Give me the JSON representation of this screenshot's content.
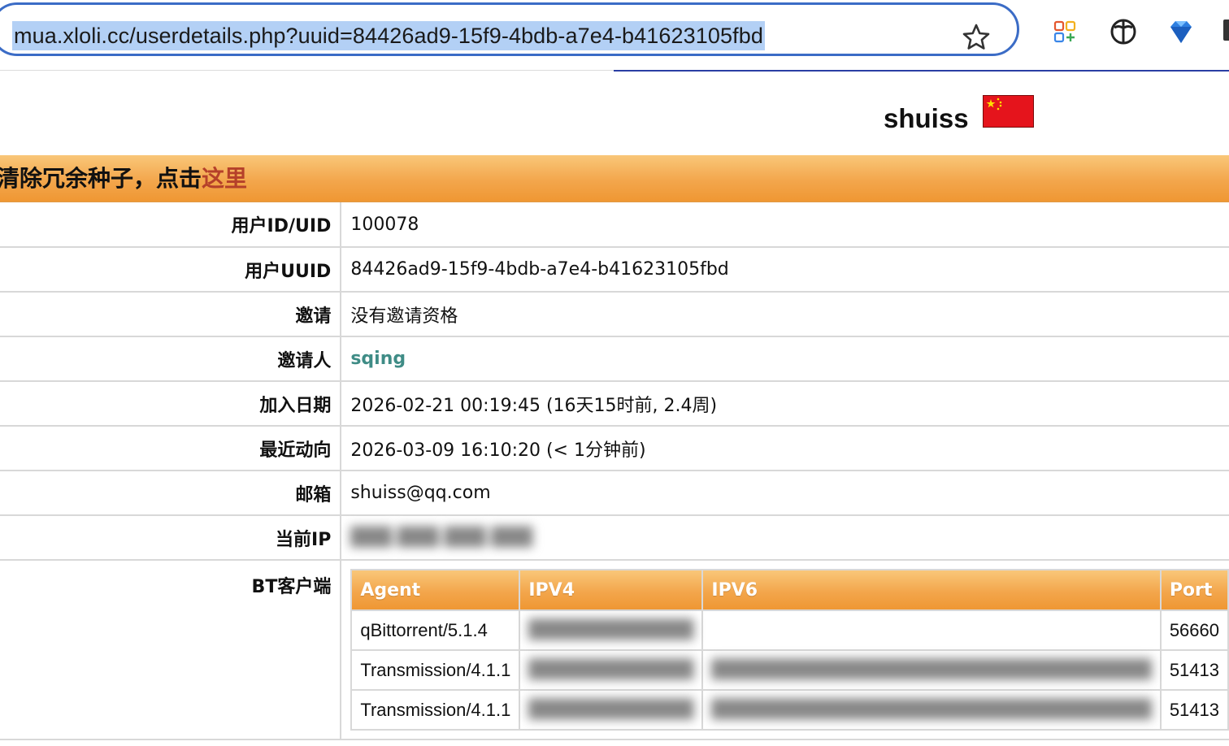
{
  "browser": {
    "url": "mua.xloli.cc/userdetails.php?uuid=84426ad9-15f9-4bdb-a7e4-b41623105fbd",
    "icons": [
      "star-icon",
      "extensions-grid-icon",
      "half-face-icon",
      "diamond-icon"
    ]
  },
  "profile": {
    "username": "shuiss",
    "country_flag": "china-flag"
  },
  "banner": {
    "text": "清除冗余种子，点击",
    "link": "这里"
  },
  "details": {
    "uid_label": "用户ID/UID",
    "uid_value": "100078",
    "uuid_label": "用户UUID",
    "uuid_value": "84426ad9-15f9-4bdb-a7e4-b41623105fbd",
    "invite_label": "邀请",
    "invite_value": "没有邀请资格",
    "inviter_label": "邀请人",
    "inviter_value": "sqing",
    "join_label": "加入日期",
    "join_value": "2026-02-21 00:19:45 (16天15时前, 2.4周)",
    "last_label": "最近动向",
    "last_value": "2026-03-09 16:10:20 (< 1分钟前)",
    "email_label": "邮箱",
    "email_value": "shuiss@qq.com",
    "ip_label": "当前IP",
    "bt_label": "BT客户端"
  },
  "bt_clients": {
    "headers": [
      "Agent",
      "IPV4",
      "IPV6",
      "Port"
    ],
    "rows": [
      {
        "agent": "qBittorrent/5.1.4",
        "port": "56660"
      },
      {
        "agent": "Transmission/4.1.1",
        "port": "51413"
      },
      {
        "agent": "Transmission/4.1.1",
        "port": "51413"
      }
    ]
  },
  "colors": {
    "focus_ring": "#3b6cc6",
    "header_orange": "#f3a64c",
    "link_red": "#b5402a",
    "inviter_teal": "#3f8c86"
  }
}
